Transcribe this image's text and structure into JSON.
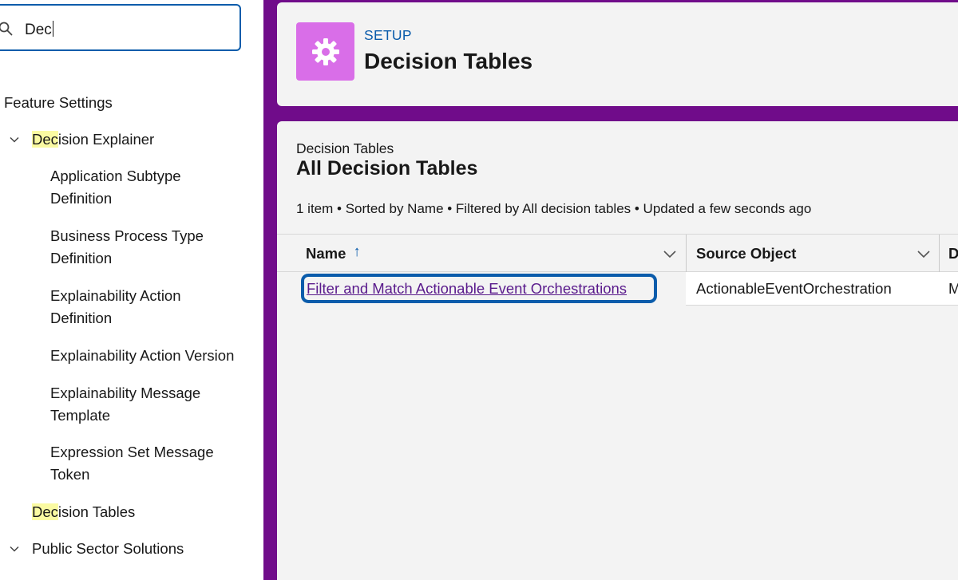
{
  "search": {
    "value": "Dec"
  },
  "sidebar": {
    "section_label": "Feature Settings",
    "items": [
      {
        "highlight": "Dec",
        "rest": "ision Explainer"
      },
      {
        "label_line1": "Application Subtype",
        "label_line2": "Definition"
      },
      {
        "label_line1": "Business Process Type",
        "label_line2": "Definition"
      },
      {
        "label_line1": "Explainability Action",
        "label_line2": "Definition"
      },
      {
        "label": "Explainability Action Version"
      },
      {
        "label_line1": "Explainability Message",
        "label_line2": "Template"
      },
      {
        "label_line1": "Expression Set Message",
        "label_line2": "Token"
      },
      {
        "highlight": "Dec",
        "rest": "ision Tables"
      },
      {
        "label": "Public Sector Solutions"
      }
    ]
  },
  "header": {
    "label": "SETUP",
    "title": "Decision Tables",
    "icon": "gear-icon"
  },
  "list": {
    "object_label": "Decision Tables",
    "view_title": "All Decision Tables",
    "meta": "1 item • Sorted by Name • Filtered by All decision tables • Updated a few seconds ago",
    "columns": [
      "Name",
      "Source Object",
      "D"
    ],
    "sort_indicator": "↑",
    "rows": [
      {
        "name": "Filter and Match Actionable Event Orchestrations",
        "source_object": "ActionableEventOrchestration",
        "next_col_peek": "M"
      }
    ]
  },
  "colors": {
    "accent": "#0b5cab",
    "purple_bg": "#700c8a",
    "header_icon_bg": "#d96ee8",
    "highlight": "#fafaa2"
  }
}
